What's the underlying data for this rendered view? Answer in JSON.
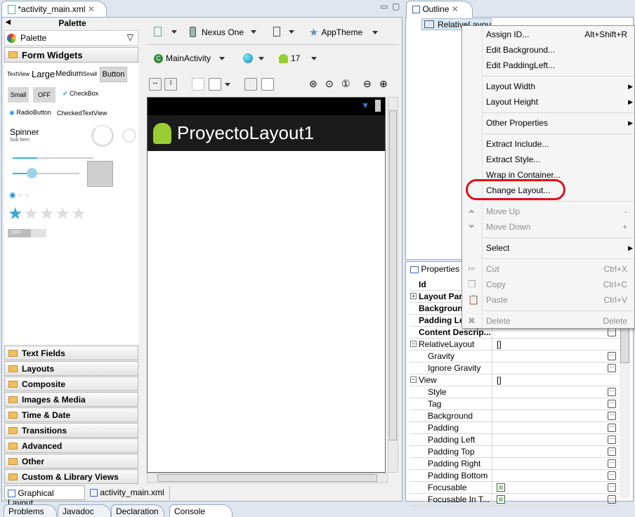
{
  "editor": {
    "tab_title": "*activity_main.xml",
    "bottom_tabs": [
      "Graphical Layout",
      "activity_main.xml"
    ]
  },
  "palette": {
    "header": "Palette",
    "dropdown": "Palette",
    "open_category": "Form Widgets",
    "widgets": {
      "textview": "TextView",
      "large": "Large",
      "medium": "Medium",
      "small": "Small",
      "button": "Button",
      "small_btn": "Small",
      "off_btn": "OFF",
      "checkbox": "CheckBox",
      "radiobutton": "RadioButton",
      "checkedtextview": "CheckedTextView",
      "spinner": "Spinner",
      "sub_item": "Sub Item",
      "switch_off": "OFF"
    },
    "categories": [
      "Text Fields",
      "Layouts",
      "Composite",
      "Images & Media",
      "Time & Date",
      "Transitions",
      "Advanced",
      "Other",
      "Custom & Library Views"
    ]
  },
  "toolbar": {
    "device": "Nexus One",
    "theme": "AppTheme",
    "activity": "MainActivity",
    "api": "17"
  },
  "preview": {
    "app_title": "ProyectoLayout1",
    "titlebar_color": "#1b1b1b"
  },
  "outline": {
    "title": "Outline",
    "item": "RelativeLayout"
  },
  "properties": {
    "title": "Properties",
    "rows": [
      {
        "k": "Id",
        "bold": true,
        "v": ""
      },
      {
        "k": "Layout Parameters",
        "bold": true,
        "v": "",
        "exp": "+"
      },
      {
        "k": "Background",
        "bold": true,
        "v": ""
      },
      {
        "k": "Padding Left",
        "bold": true,
        "v": ""
      },
      {
        "k": "Content Descrip...",
        "bold": true,
        "v": "",
        "dots": true
      },
      {
        "k": "RelativeLayout",
        "v": "[]",
        "exp": "-"
      },
      {
        "k": "Gravity",
        "indent": true,
        "v": "",
        "dots": true
      },
      {
        "k": "Ignore Gravity",
        "indent": true,
        "v": "",
        "dots": true
      },
      {
        "k": "View",
        "v": "[]",
        "exp": "-"
      },
      {
        "k": "Style",
        "indent": true,
        "v": "",
        "dots": true
      },
      {
        "k": "Tag",
        "indent": true,
        "v": "",
        "dots": true
      },
      {
        "k": "Background",
        "indent": true,
        "v": "",
        "dots": true
      },
      {
        "k": "Padding",
        "indent": true,
        "v": "",
        "dots": true
      },
      {
        "k": "Padding Left",
        "indent": true,
        "v": "",
        "dots": true
      },
      {
        "k": "Padding Top",
        "indent": true,
        "v": "",
        "dots": true
      },
      {
        "k": "Padding Right",
        "indent": true,
        "v": "",
        "dots": true
      },
      {
        "k": "Padding Bottom",
        "indent": true,
        "v": "",
        "dots": true
      },
      {
        "k": "Focusable",
        "indent": true,
        "v": "",
        "dots": true,
        "check": true
      },
      {
        "k": "Focusable In T...",
        "indent": true,
        "v": "",
        "dots": true,
        "check": true
      }
    ]
  },
  "context_menu": {
    "highlight_color": "#e0101a",
    "items": [
      {
        "label": "Assign ID...",
        "shortcut": "Alt+Shift+R"
      },
      {
        "label": "Edit Background..."
      },
      {
        "label": "Edit PaddingLeft...",
        "sep_after": true
      },
      {
        "label": "Layout Width",
        "submenu": true
      },
      {
        "label": "Layout Height",
        "submenu": true,
        "sep_after": true
      },
      {
        "label": "Other Properties",
        "submenu": true,
        "sep_after": true
      },
      {
        "label": "Extract Include..."
      },
      {
        "label": "Extract Style..."
      },
      {
        "label": "Wrap in Container..."
      },
      {
        "label": "Change Layout...",
        "highlighted": true,
        "sep_after": true
      },
      {
        "label": "Move Up",
        "shortcut": "-",
        "disabled": true,
        "icon": "arrow-up-icon"
      },
      {
        "label": "Move Down",
        "shortcut": "+",
        "disabled": true,
        "icon": "arrow-down-icon",
        "sep_after": true
      },
      {
        "label": "Select",
        "submenu": true,
        "sep_after": true
      },
      {
        "label": "Cut",
        "shortcut": "Ctrl+X",
        "disabled": true,
        "icon": "scissors-icon"
      },
      {
        "label": "Copy",
        "shortcut": "Ctrl+C",
        "disabled": true,
        "icon": "copy-icon"
      },
      {
        "label": "Paste",
        "shortcut": "Ctrl+V",
        "disabled": true,
        "icon": "paste-icon",
        "sep_after": true
      },
      {
        "label": "Delete",
        "shortcut": "Delete",
        "disabled": true,
        "icon": "delete-icon"
      }
    ]
  },
  "bottom_views": [
    "Problems",
    "Javadoc",
    "Declaration",
    "Console"
  ]
}
